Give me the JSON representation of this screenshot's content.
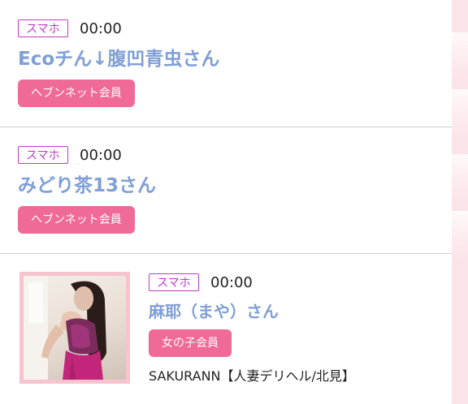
{
  "entries": [
    {
      "device": "スマホ",
      "time": "00:00",
      "name": "Ecoチん↓腹凹青虫さん",
      "member": "ヘブンネット会員"
    },
    {
      "device": "スマホ",
      "time": "00:00",
      "name": "みどり茶13さん",
      "member": "ヘブンネット会員"
    },
    {
      "device": "スマホ",
      "time": "00:00",
      "name": "麻耶（まや）さん",
      "member": "女の子会員",
      "shop": "SAKURANN【人妻デリヘル/北見】",
      "photo_alt": "girl-photo"
    }
  ],
  "colors": {
    "device_badge": "#c13ac9",
    "name": "#7f9fd6",
    "member_button": "#f06a98",
    "thumb_frame": "#f7c3cf"
  }
}
